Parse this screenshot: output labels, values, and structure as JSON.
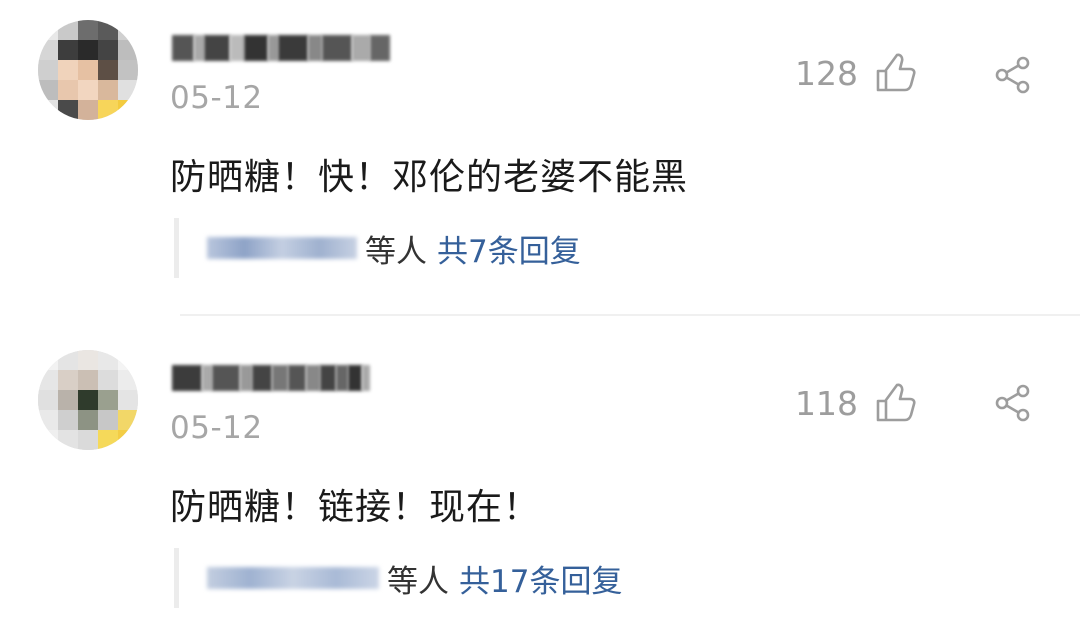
{
  "comments": [
    {
      "date": "05-12",
      "likes": "128",
      "text": "防晒糖！快！邓伦的老婆不能黑",
      "replies_who": "等人",
      "replies_count": "共7条回复"
    },
    {
      "date": "05-12",
      "likes": "118",
      "text": "防晒糖！链接！现在！",
      "replies_who": "等人",
      "replies_count": "共17条回复"
    }
  ],
  "colors": {
    "link": "#35609a",
    "muted": "#a6a6a6",
    "text": "#1a1a1a"
  },
  "icons": [
    "like-icon",
    "share-icon"
  ]
}
